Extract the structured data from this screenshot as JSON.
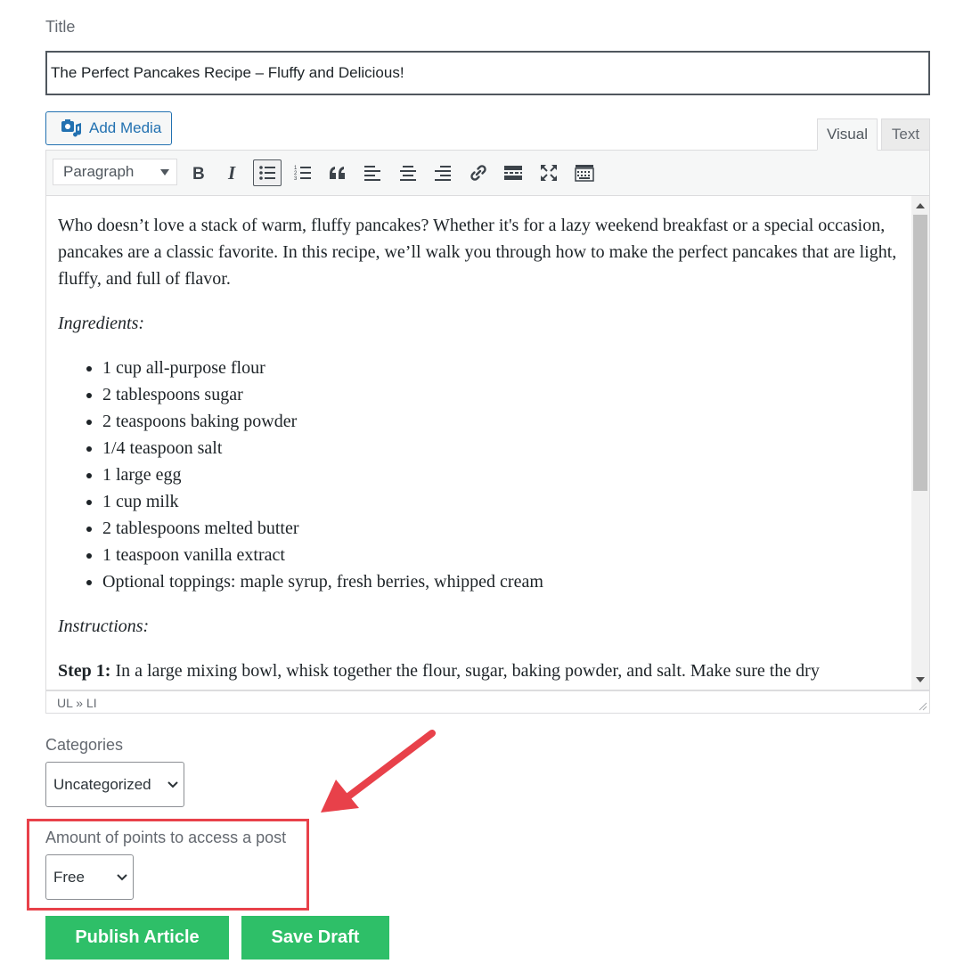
{
  "title_field": {
    "label": "Title",
    "value": "The Perfect Pancakes Recipe – Fluffy and Delicious!"
  },
  "editor": {
    "add_media_label": "Add Media",
    "tabs": [
      {
        "label": "Visual",
        "active": true
      },
      {
        "label": "Text",
        "active": false
      }
    ],
    "format_select_value": "Paragraph",
    "toolbar_icons": [
      "bold-icon",
      "italic-icon",
      "bulleted-list-icon",
      "numbered-list-icon",
      "blockquote-icon",
      "align-left-icon",
      "align-center-icon",
      "align-right-icon",
      "link-icon",
      "read-more-icon",
      "fullscreen-icon",
      "toolbar-toggle-icon"
    ],
    "content": {
      "intro": "Who doesn’t love a stack of warm, fluffy pancakes? Whether it's for a lazy weekend breakfast or a special occasion, pancakes are a classic favorite. In this recipe, we’ll walk you through how to make the perfect pancakes that are light, fluffy, and full of flavor.",
      "ingredients_heading": "Ingredients:",
      "ingredients": [
        "1 cup all-purpose flour",
        "2 tablespoons sugar",
        "2 teaspoons baking powder",
        "1/4 teaspoon salt",
        "1 large egg",
        "1 cup milk",
        "2 tablespoons melted butter",
        "1 teaspoon vanilla extract",
        "Optional toppings: maple syrup, fresh berries, whipped cream"
      ],
      "instructions_heading": "Instructions:",
      "step1_label": "Step 1:",
      "step1_text": " In a large mixing bowl, whisk together the flour, sugar, baking powder, and salt. Make sure the dry"
    },
    "status_path": "UL » LI"
  },
  "categories": {
    "label": "Categories",
    "selected": "Uncategorized"
  },
  "points": {
    "label": "Amount of points to access a post",
    "selected": "Free"
  },
  "actions": {
    "publish_label": "Publish Article",
    "save_draft_label": "Save Draft"
  },
  "colors": {
    "accent_blue": "#2271b1",
    "button_green": "#2ebf68",
    "highlight_red": "#e8414a"
  }
}
